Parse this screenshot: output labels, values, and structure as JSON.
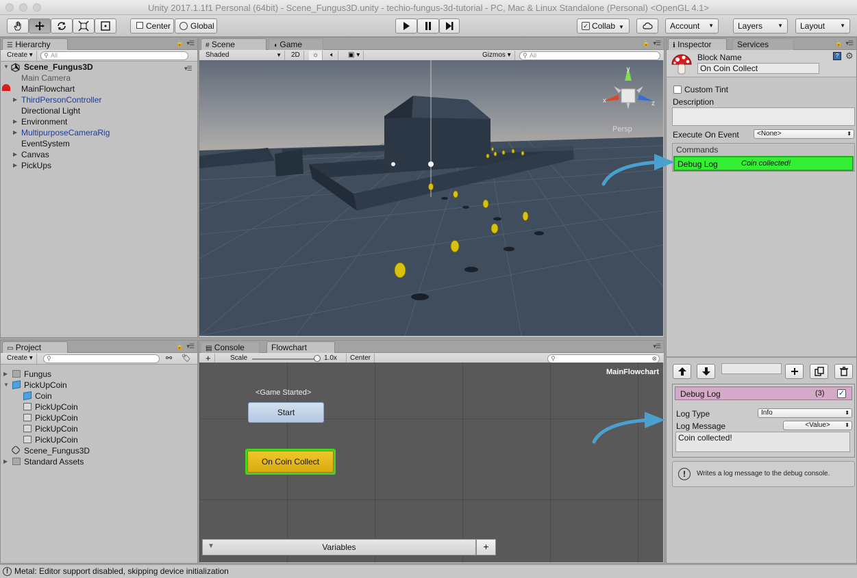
{
  "window": {
    "title": "Unity 2017.1.1f1 Personal (64bit) - Scene_Fungus3D.unity - techio-fungus-3d-tutorial - PC, Mac & Linux Standalone (Personal) <OpenGL 4.1>"
  },
  "toolbar": {
    "pivot_label": "Center",
    "space_label": "Global",
    "collab_label": "Collab",
    "account_label": "Account",
    "layers_label": "Layers",
    "layout_label": "Layout"
  },
  "hierarchy": {
    "tab": "Hierarchy",
    "create": "Create",
    "search_placeholder": "All",
    "scene": "Scene_Fungus3D",
    "items": [
      "Main Camera",
      "MainFlowchart",
      "ThirdPersonController",
      "Directional Light",
      "Environment",
      "MultipurposeCameraRig",
      "EventSystem",
      "Canvas",
      "PickUps"
    ]
  },
  "scene": {
    "tab_scene": "Scene",
    "tab_game": "Game",
    "shading": "Shaded",
    "mode2d": "2D",
    "gizmos": "Gizmos",
    "search_placeholder": "All",
    "persp": "Persp",
    "axis_y": "y",
    "axis_x": "x",
    "axis_z": "z"
  },
  "project": {
    "tab": "Project",
    "create": "Create",
    "items": [
      "Fungus",
      "PickUpCoin",
      "Coin",
      "PickUpCoin",
      "PickUpCoin",
      "PickUpCoin",
      "PickUpCoin",
      "Scene_Fungus3D",
      "Standard Assets"
    ]
  },
  "flowchart": {
    "tab_console": "Console",
    "tab_flowchart": "Flowchart",
    "add": "+",
    "scale_label": "Scale",
    "scale_value": "1.0x",
    "center": "Center",
    "name": "MainFlowchart",
    "event_label": "<Game Started>",
    "start_block": "Start",
    "coin_block": "On Coin Collect",
    "variables": "Variables",
    "variables_add": "+"
  },
  "inspector": {
    "tab_inspector": "Inspector",
    "tab_services": "Services",
    "block_name_label": "Block Name",
    "block_name_value": "On Coin Collect",
    "custom_tint": "Custom Tint",
    "description": "Description",
    "execute_label": "Execute On Event",
    "execute_value": "<None>",
    "commands_label": "Commands",
    "command_name": "Debug Log",
    "command_summary": "Coin collected!",
    "cmd_header": "Debug Log",
    "cmd_index": "(3)",
    "log_type_label": "Log Type",
    "log_type_value": "Info",
    "log_message_label": "Log Message",
    "log_message_value": "<Value>",
    "message_text": "Coin collected!",
    "help_text": "Writes a log message to the debug console."
  },
  "status": {
    "message": "Metal: Editor support disabled, skipping device initialization"
  },
  "colors": {
    "command_selected": "#33ee33",
    "coin_block": "#e5b81c",
    "start_block": "#b9cde6",
    "arrow": "#4aa0cf",
    "cmd_header": "#d5a9c8"
  }
}
